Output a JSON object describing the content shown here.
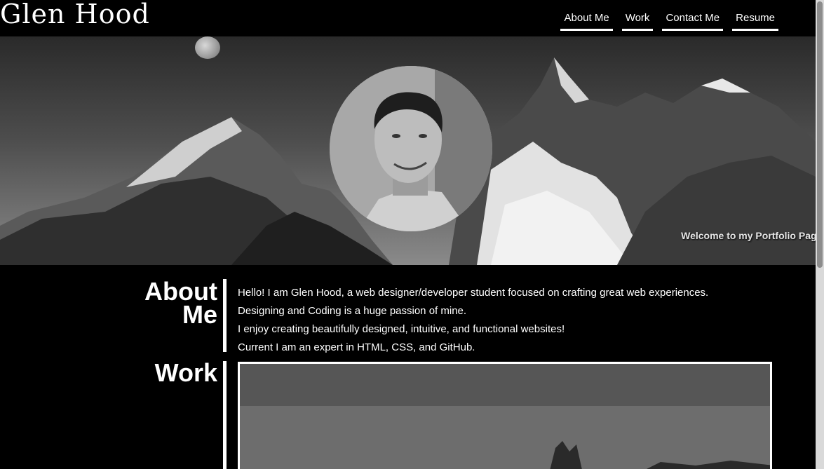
{
  "header": {
    "logo": "Glen Hood",
    "nav": [
      "About Me",
      "Work",
      "Contact Me",
      "Resume"
    ]
  },
  "hero": {
    "welcome": "Welcome to my Portfolio Page!"
  },
  "about": {
    "title_line1": "About",
    "title_line2": "Me",
    "lines": [
      "Hello! I am Glen Hood, a web designer/developer student focused on crafting great web experiences.",
      "Designing and Coding is a huge passion of mine.",
      "I enjoy creating beautifully designed, intuitive, and functional websites!",
      "Current I am an expert in HTML, CSS, and GitHub."
    ]
  },
  "work": {
    "title": "Work"
  }
}
